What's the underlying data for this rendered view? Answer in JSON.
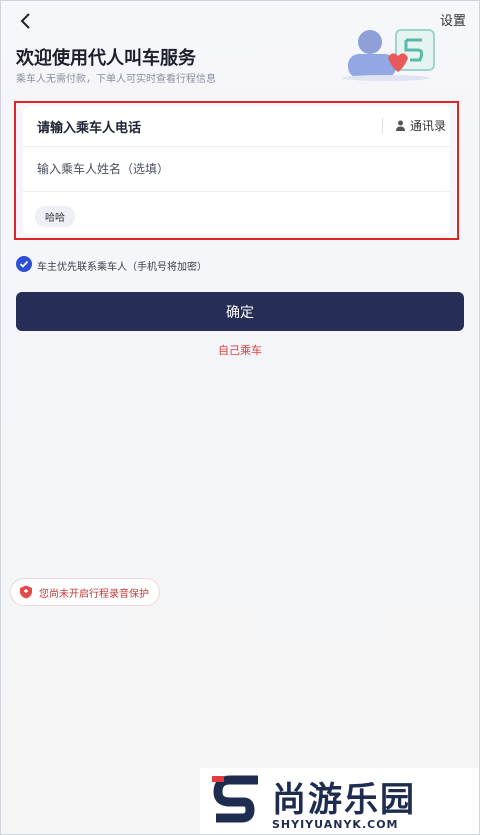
{
  "header": {
    "settings_label": "设置"
  },
  "hero": {
    "title": "欢迎使用代人叫车服务",
    "subtitle": "乘车人无需付款，下单人可实时查看行程信息"
  },
  "form": {
    "phone_placeholder": "请输入乘车人电话",
    "contacts_label": "通讯录",
    "name_placeholder": "输入乘车人姓名（选填）",
    "recent_passenger": "哈哈"
  },
  "privacy": {
    "checked": true,
    "label": "车主优先联系乘车人（手机号将加密）"
  },
  "actions": {
    "confirm_label": "确定",
    "self_ride_label": "自己乘车"
  },
  "recording": {
    "label": "您尚未开启行程录音保护"
  },
  "watermark": {
    "brand": "尚游乐园",
    "url": "SHYIYUANYK.COM"
  },
  "colors": {
    "primary": "#262e57",
    "accent_red": "#e43b3b",
    "highlight": "#e02424",
    "check_blue": "#2d4fd6"
  }
}
